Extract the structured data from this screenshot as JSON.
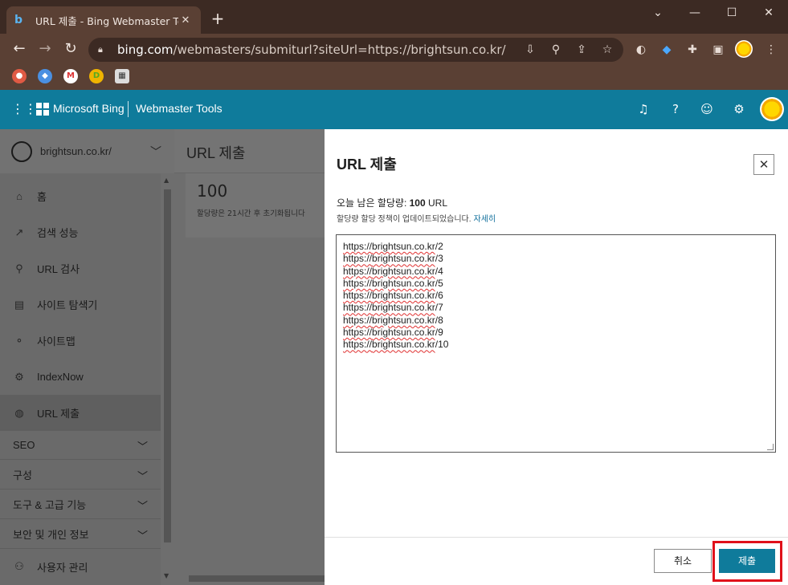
{
  "browser": {
    "tab_title": "URL 제출 - Bing Webmaster Tools",
    "tab_close": "✕",
    "new_tab": "+",
    "url_host": "bing.com",
    "url_path": "/webmasters/submiturl?siteUrl=https://brightsun.co.kr/",
    "window_controls": {
      "collapse": "⌄",
      "minimize": "—",
      "maximize": "☐",
      "close": "✕"
    }
  },
  "header": {
    "brand": "Microsoft Bing",
    "product": "Webmaster Tools"
  },
  "sidebar": {
    "site": "brightsun.co.kr/",
    "items": [
      {
        "label": "홈",
        "icon": "⌂"
      },
      {
        "label": "검색 성능",
        "icon": "↗"
      },
      {
        "label": "URL 검사",
        "icon": "⚲"
      },
      {
        "label": "사이트 탐색기",
        "icon": "▤"
      },
      {
        "label": "사이트맵",
        "icon": "⚬"
      },
      {
        "label": "IndexNow",
        "icon": "⚙"
      },
      {
        "label": "URL 제출",
        "icon": "◍"
      }
    ],
    "groups": [
      {
        "label": "SEO"
      },
      {
        "label": "구성"
      },
      {
        "label": "도구 & 고급 기능"
      },
      {
        "label": "보안 및 개인 정보"
      }
    ],
    "user_mgmt": "사용자 관리"
  },
  "main": {
    "page_title": "URL 제출",
    "quota_number": "100",
    "quota_note": "할당량은 21시간 후 초기화됩니다"
  },
  "panel": {
    "title": "URL 제출",
    "quota_prefix": "오늘 남은 할당량: ",
    "quota_value": "100",
    "quota_unit": " URL",
    "policy_text": "할당량 할당 정책이 업데이트되었습니다.",
    "policy_link": "자세히",
    "urls": [
      {
        "scheme": "https://",
        "host": "brightsun.co.kr",
        "path": "/2"
      },
      {
        "scheme": "https://",
        "host": "brightsun.co.kr",
        "path": "/3"
      },
      {
        "scheme": "https://",
        "host": "brightsun.co.kr",
        "path": "/4"
      },
      {
        "scheme": "https://",
        "host": "brightsun.co.kr",
        "path": "/5"
      },
      {
        "scheme": "https://",
        "host": "brightsun.co.kr",
        "path": "/6"
      },
      {
        "scheme": "https://",
        "host": "brightsun.co.kr",
        "path": "/7"
      },
      {
        "scheme": "https://",
        "host": "brightsun.co.kr",
        "path": "/8"
      },
      {
        "scheme": "https://",
        "host": "brightsun.co.kr",
        "path": "/9"
      },
      {
        "scheme": "https://",
        "host": "brightsun.co.kr",
        "path": "/10"
      }
    ],
    "cancel_label": "취소",
    "submit_label": "제출"
  },
  "colors": {
    "brand_teal": "#0f7b9b",
    "highlight_red": "#e0101a",
    "chrome_dark": "#3c2a23"
  }
}
